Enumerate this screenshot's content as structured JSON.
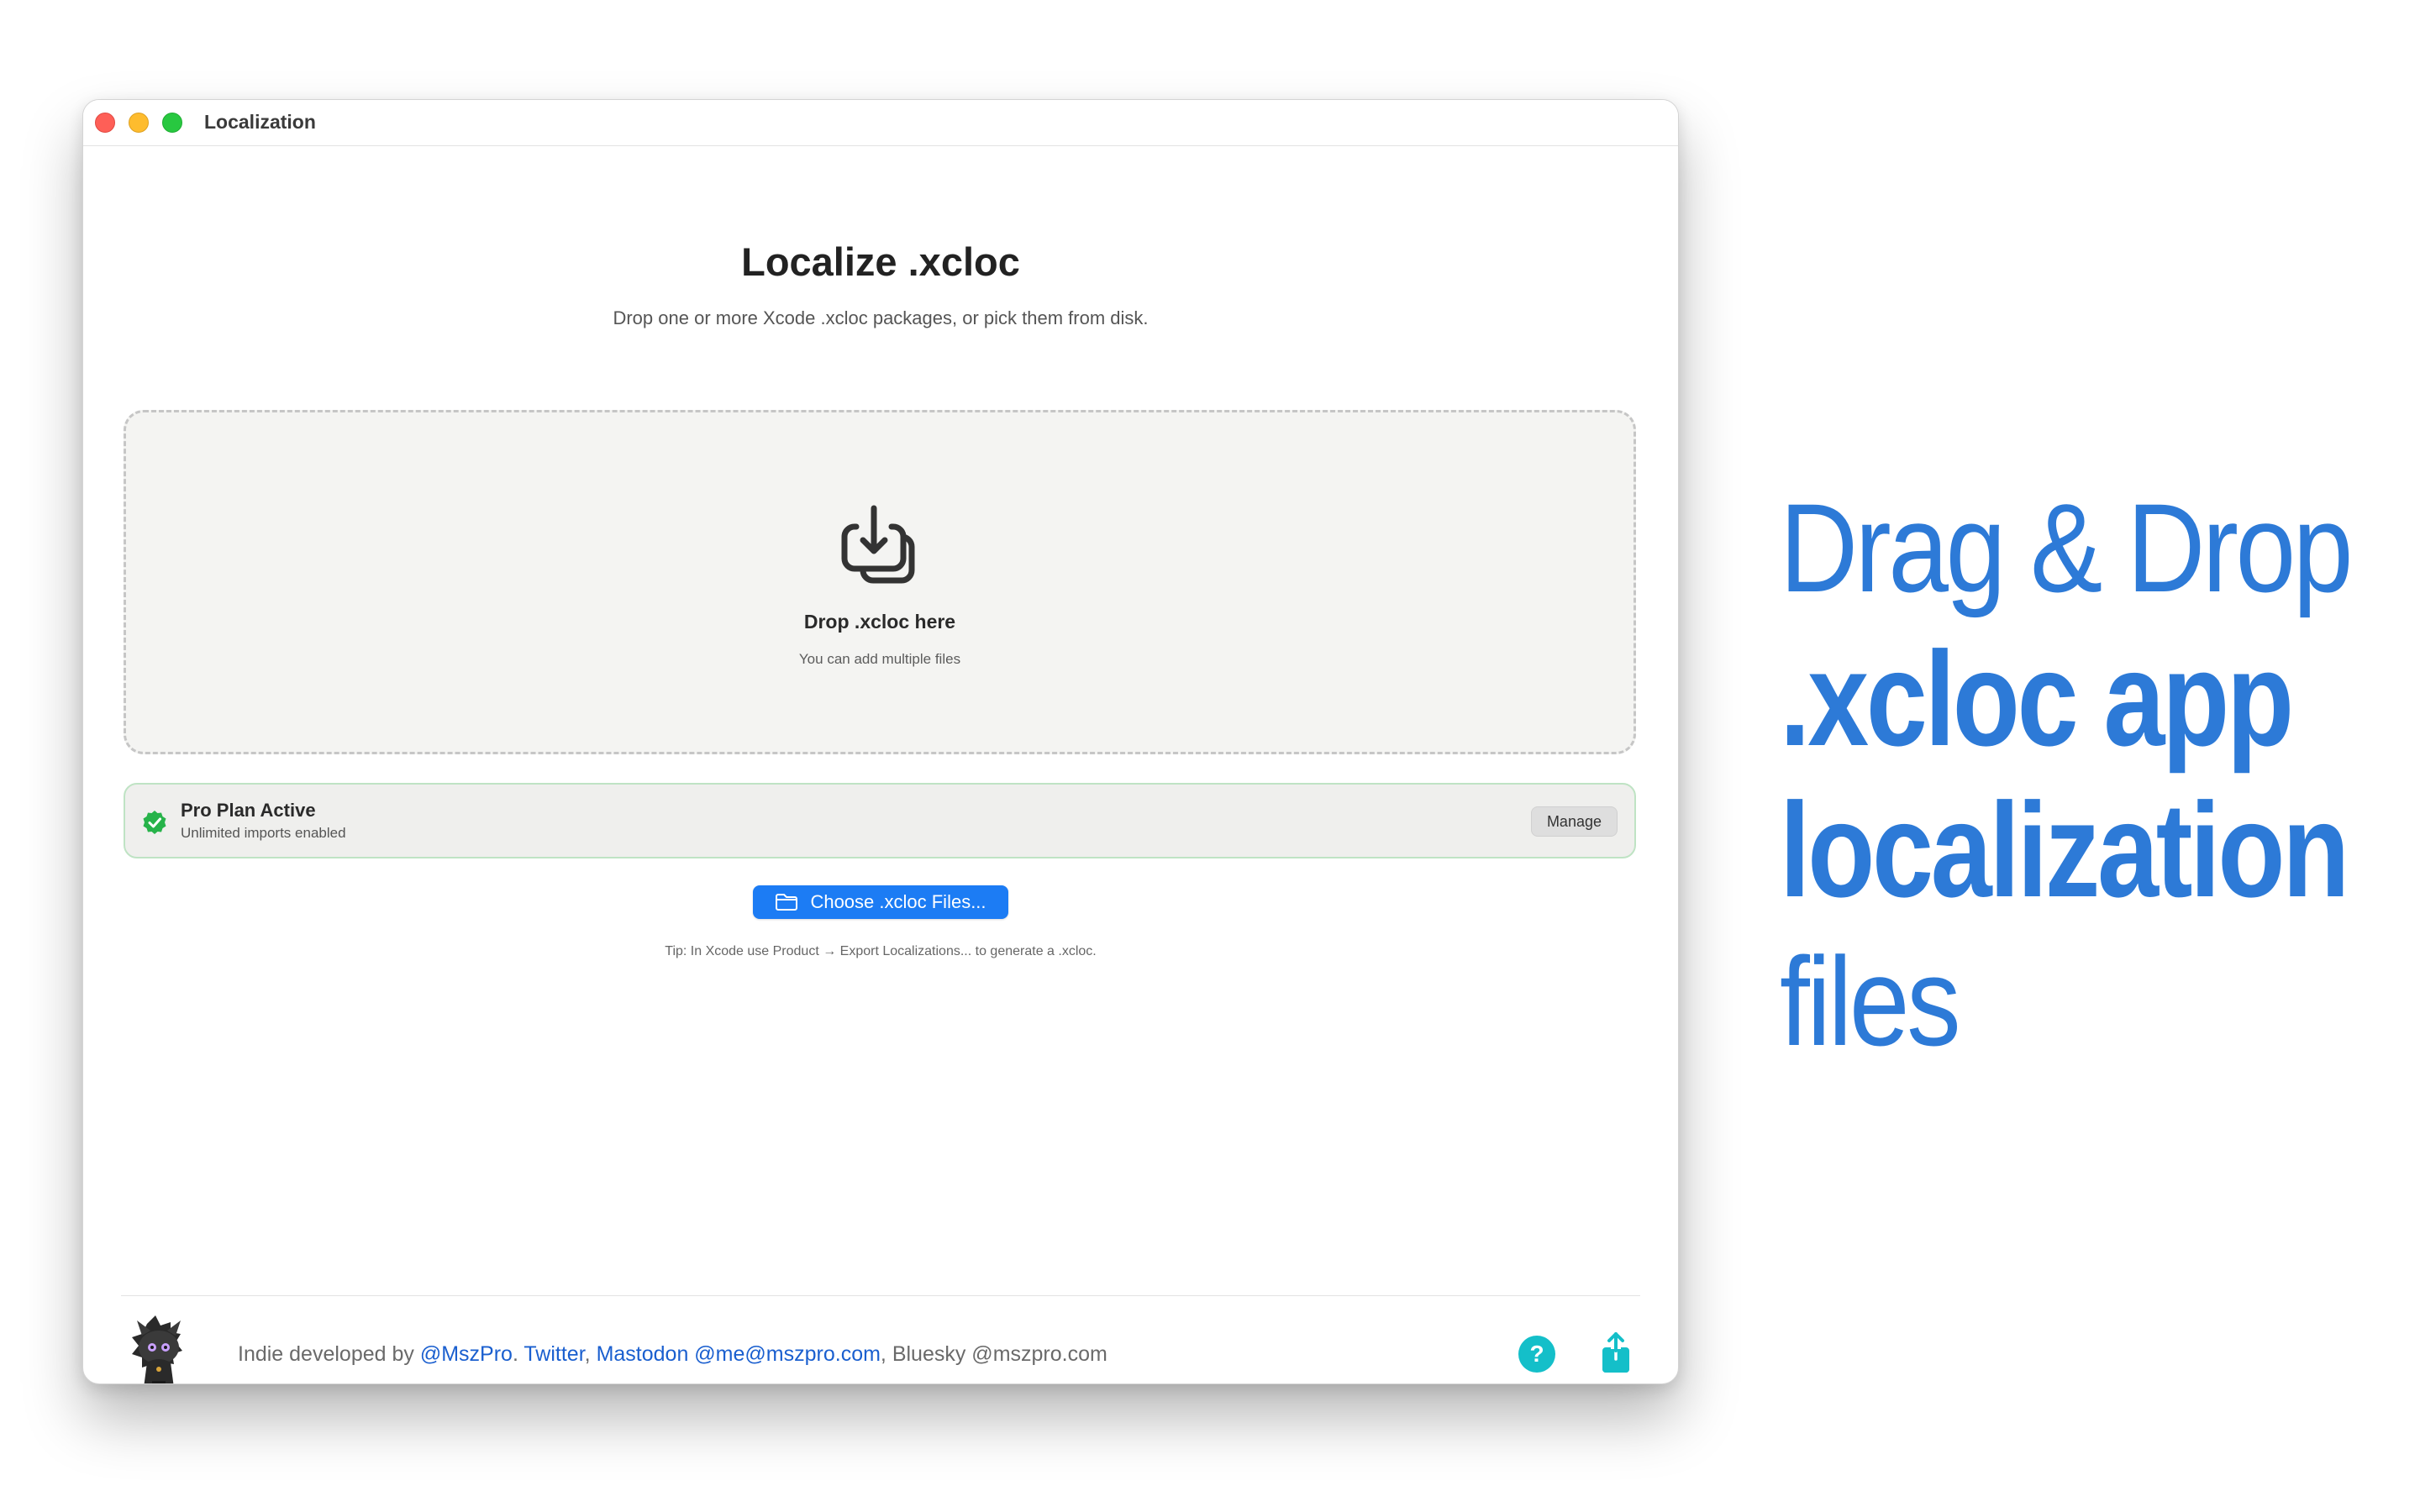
{
  "window": {
    "title": "Localization"
  },
  "main": {
    "title": "Localize .xcloc",
    "subtitle": "Drop one or more Xcode .xcloc packages, or pick them from disk.",
    "dropzone": {
      "icon": "tray-download-icon",
      "title": "Drop .xcloc here",
      "subtitle": "You can add multiple files"
    },
    "plan": {
      "icon": "checkmark-seal-icon",
      "title": "Pro Plan Active",
      "subtitle": "Unlimited imports enabled",
      "manage_label": "Manage"
    },
    "choose_button_label": "Choose .xcloc Files...",
    "tip": "Tip: In Xcode use Product → Export Localizations... to generate a .xcloc."
  },
  "footer": {
    "prefix": "Indie developed by ",
    "handle": "@MszPro",
    "sep1": ". ",
    "twitter": "Twitter",
    "sep2": ", ",
    "mastodon": "Mastodon @me@mszpro.com",
    "sep3": ", ",
    "bluesky": "Bluesky @mszpro.com",
    "help_label": "?"
  },
  "promo": {
    "line1": "Drag & Drop",
    "line2": ".xcloc app",
    "line3": "localization",
    "line4": "files"
  },
  "colors": {
    "accent": "#1c7cf4",
    "promo": "#2d7ad7",
    "link": "#1a5fcf",
    "success": "#27b34a",
    "help": "#14bfc9"
  }
}
